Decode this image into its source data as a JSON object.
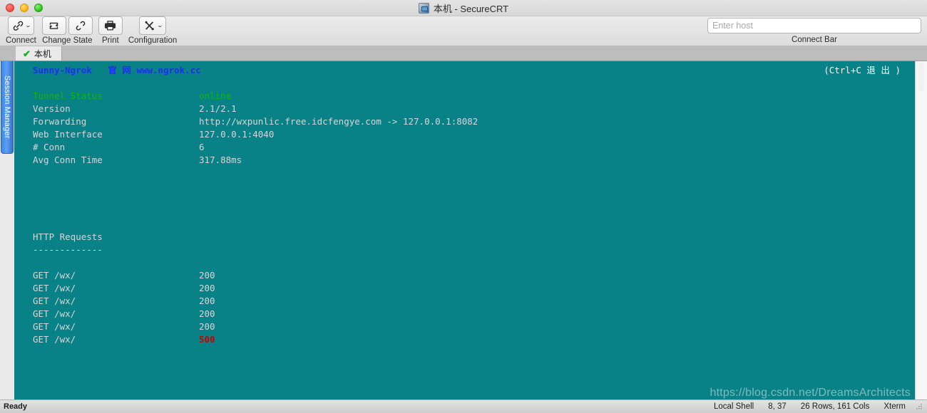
{
  "window": {
    "title": "本机 - SecureCRT",
    "title_icon": "securecrt-app-icon",
    "traffic": {
      "close": "close-button",
      "minimize": "minimize-button",
      "zoom": "zoom-button"
    }
  },
  "toolbar": {
    "items": [
      {
        "label": "Connect",
        "icon": "link-icon",
        "has_caret": true
      },
      {
        "label": "Change State",
        "icons": [
          "reconnect-icon",
          "disconnect-icon"
        ],
        "has_caret": false
      },
      {
        "label": "Print",
        "icon": "printer-icon",
        "has_caret": false
      },
      {
        "label": "Configuration",
        "icon": "tools-icon",
        "has_caret": true
      }
    ],
    "connect_bar": {
      "placeholder": "Enter host",
      "value": "",
      "label": "Connect Bar"
    }
  },
  "tabs": [
    {
      "label": "本机",
      "status_icon": "check-icon",
      "active": true
    }
  ],
  "session_manager": {
    "label": "Session Manager"
  },
  "terminal": {
    "background": "#088286",
    "ctrl_hint": "(Ctrl+C 退 出 )",
    "watermark": "https://blog.csdn.net/DreamsArchitects",
    "banner": {
      "brand": "Sunny-Ngrok",
      "official_label": "官 网",
      "site": "www.ngrok.cc"
    },
    "status": {
      "rows": [
        {
          "key": "Tunnel Status",
          "value": "online",
          "key_color": "green",
          "value_color": "green"
        },
        {
          "key": "Version",
          "value": "2.1/2.1",
          "key_color": "white",
          "value_color": "white"
        },
        {
          "key": "Forwarding",
          "value": "http://wxpunlic.free.idcfengye.com -> 127.0.0.1:8082",
          "key_color": "white",
          "value_color": "white"
        },
        {
          "key": "Web Interface",
          "value": "127.0.0.1:4040",
          "key_color": "white",
          "value_color": "white"
        },
        {
          "key": "# Conn",
          "value": "6",
          "key_color": "white",
          "value_color": "white"
        },
        {
          "key": "Avg Conn Time",
          "value": "317.88ms",
          "key_color": "white",
          "value_color": "white"
        }
      ]
    },
    "requests": {
      "heading": "HTTP Requests",
      "rule": "-------------",
      "rows": [
        {
          "request": "GET /wx/",
          "status": "200",
          "status_color": "white"
        },
        {
          "request": "GET /wx/",
          "status": "200",
          "status_color": "white"
        },
        {
          "request": "GET /wx/",
          "status": "200",
          "status_color": "white"
        },
        {
          "request": "GET /wx/",
          "status": "200",
          "status_color": "white"
        },
        {
          "request": "GET /wx/",
          "status": "200",
          "status_color": "white"
        },
        {
          "request": "GET /wx/",
          "status": "500",
          "status_color": "red"
        }
      ]
    }
  },
  "statusbar": {
    "ready": "Ready",
    "shell": "Local Shell",
    "cursor": "8, 37",
    "dimensions": "26 Rows, 161 Cols",
    "emulation": "Xterm"
  }
}
